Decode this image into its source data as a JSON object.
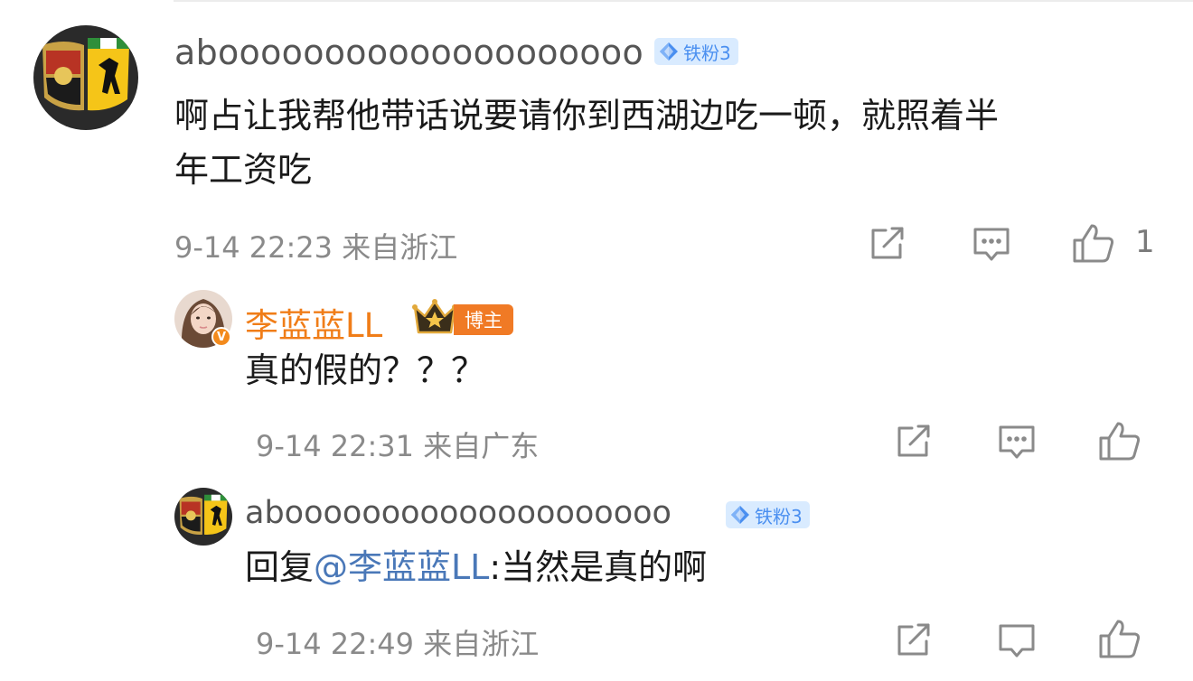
{
  "comments": [
    {
      "username": "aboooooooooooooooooooo",
      "fan_badge": "铁粉3",
      "text_line1": "啊占让我帮他带话说要请你到西湖边吃一顿，就照着半",
      "text_line2": "年工资吃",
      "meta": "9-14 22:23 来自浙江",
      "like_count": "1"
    }
  ],
  "replies": [
    {
      "username": "李蓝蓝LL",
      "verified_badge": "V",
      "role_badge": "博主",
      "text": "真的假的？？？",
      "meta": "9-14 22:31 来自广东"
    },
    {
      "username": "aboooooooooooooooooooo",
      "fan_badge": "铁粉3",
      "text_prefix": "回复",
      "mention": "@李蓝蓝LL",
      "text_suffix": ":当然是真的啊",
      "meta": "9-14 22:49 来自浙江"
    }
  ],
  "icons": [
    "share-icon",
    "comment-icon",
    "like-icon"
  ],
  "colors": {
    "blogger_name": "#f07d18",
    "mention": "#4a78b8",
    "fan_badge_bg": "#d9ebff",
    "fan_badge_text": "#4a8ff0",
    "blogger_badge_bg": "#f07a25"
  }
}
